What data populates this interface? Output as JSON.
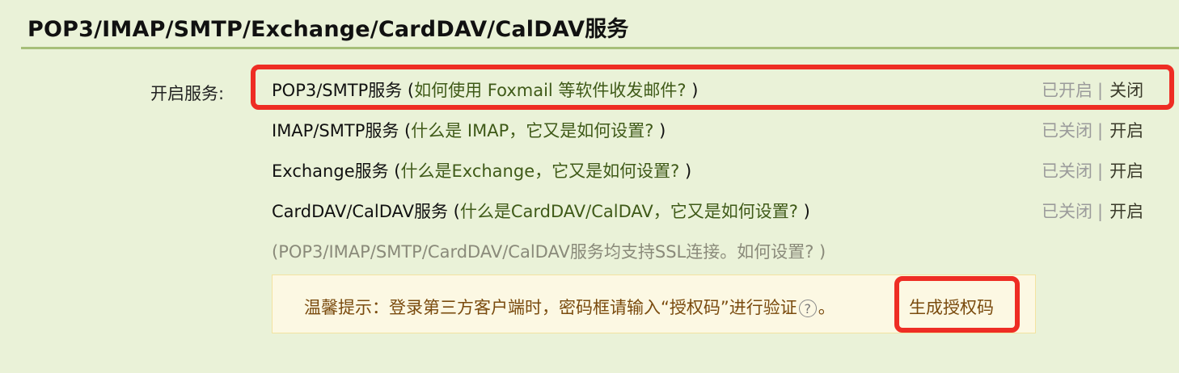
{
  "section": {
    "title": "POP3/IMAP/SMTP/Exchange/CardDAV/CalDAV服务",
    "row_label": "开启服务:"
  },
  "services": [
    {
      "name": "POP3/SMTP服务",
      "open_paren": " (",
      "help": "如何使用 Foxmail 等软件收发邮件?",
      "close_paren": " )",
      "status": "已开启",
      "sep": "|",
      "action": "关闭"
    },
    {
      "name": "IMAP/SMTP服务",
      "open_paren": " (",
      "help": "什么是 IMAP，它又是如何设置?",
      "close_paren": " )",
      "status": "已关闭",
      "sep": "|",
      "action": "开启"
    },
    {
      "name": "Exchange服务",
      "open_paren": " (",
      "help": "什么是Exchange，它又是如何设置?",
      "close_paren": " )",
      "status": "已关闭",
      "sep": "|",
      "action": "开启"
    },
    {
      "name": "CardDAV/CalDAV服务",
      "open_paren": " (",
      "help": "什么是CardDAV/CalDAV，它又是如何设置?",
      "close_paren": " )",
      "status": "已关闭",
      "sep": "|",
      "action": "开启"
    }
  ],
  "ssl_note": "(POP3/IMAP/SMTP/CardDAV/CalDAV服务均支持SSL连接。如何设置? )",
  "tip": {
    "text": "温馨提示：登录第三方客户端时，密码框请输入“授权码”进行验证",
    "help_glyph": "?",
    "period": "。",
    "link": "生成授权码"
  },
  "colors": {
    "background": "#eaf2d8",
    "rule": "#a6bf79",
    "highlight": "#ee2d24",
    "help_link": "#3f5a18",
    "tip_bg": "#fcf8e3"
  }
}
